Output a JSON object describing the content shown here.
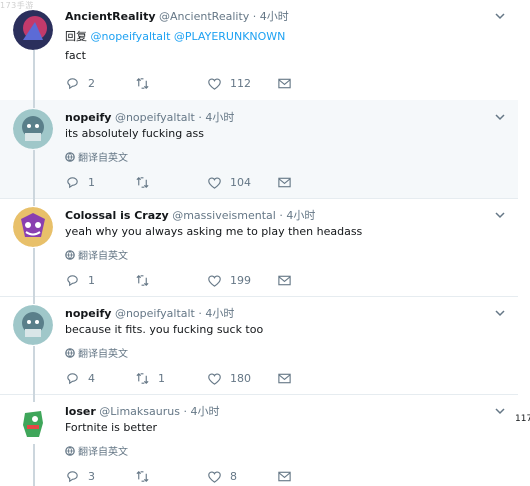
{
  "watermark": "173手游",
  "stray_number": "117",
  "tweets": [
    {
      "name": "AncientReality",
      "handle": "@AncientReality",
      "time": "· 4小时",
      "reply_prefix": "回复",
      "reply_to": "@nopeifyaltalt @PLAYERUNKNOWN",
      "text": "fact",
      "translate": "",
      "replies": "2",
      "retweets": "",
      "likes": "112"
    },
    {
      "name": "nopeify",
      "handle": "@nopeifyaltalt",
      "time": "· 4小时",
      "text": "its absolutely fucking ass",
      "translate": "翻译自英文",
      "replies": "1",
      "retweets": "",
      "likes": "104"
    },
    {
      "name": "Colossal is Crazy",
      "handle": "@massiveismental",
      "time": "· 4小时",
      "text": "yeah why you always asking me to play then headass",
      "translate": "翻译自英文",
      "replies": "1",
      "retweets": "",
      "likes": "199"
    },
    {
      "name": "nopeify",
      "handle": "@nopeifyaltalt",
      "time": "· 4小时",
      "text": "because it fits. you fucking suck too",
      "translate": "翻译自英文",
      "replies": "4",
      "retweets": "1",
      "likes": "180"
    },
    {
      "name": "loser",
      "handle": "@Limaksaurus",
      "time": "· 4小时",
      "text": "Fortnite is better",
      "translate": "翻译自英文",
      "replies": "3",
      "retweets": "",
      "likes": "8"
    }
  ],
  "colors": {
    "text": "#14171a",
    "muted": "#657786",
    "link": "#1da1f2",
    "highlight_bg": "#f5f8fa",
    "thread_line": "#ccd6dd"
  },
  "icons": [
    "reply-icon",
    "retweet-icon",
    "like-icon",
    "message-icon",
    "chevron-down-icon",
    "globe-icon"
  ]
}
